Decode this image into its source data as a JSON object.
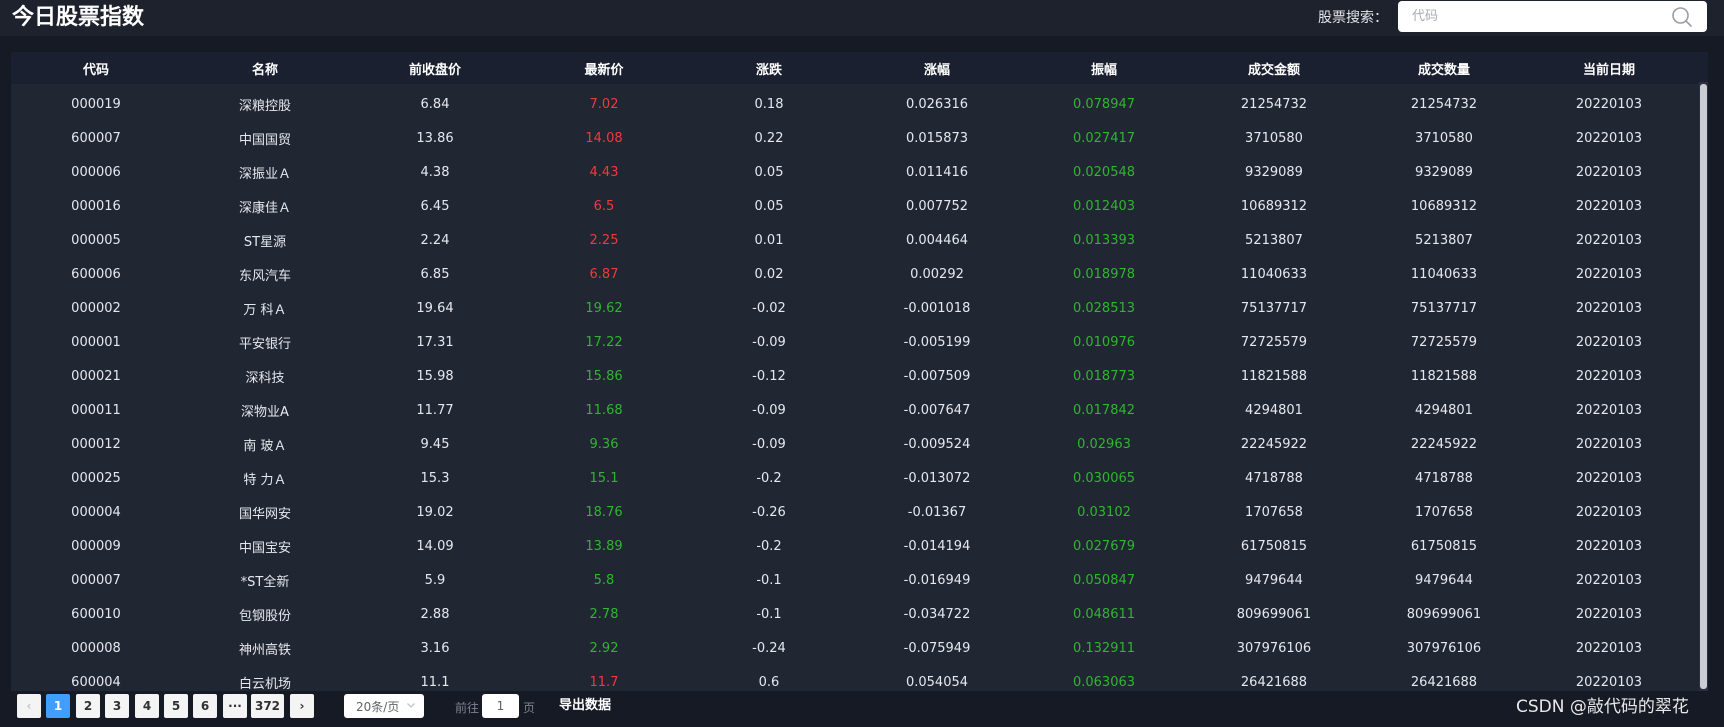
{
  "header": {
    "title": "今日股票指数",
    "search_label": "股票搜索：",
    "search_placeholder": "代码",
    "search_value": ""
  },
  "table": {
    "columns": [
      "代码",
      "名称",
      "前收盘价",
      "最新价",
      "涨跌",
      "涨幅",
      "振幅",
      "成交金额",
      "成交数量",
      "当前日期"
    ],
    "rows": [
      [
        "000019",
        "深粮控股",
        "6.84",
        "7.02",
        "0.18",
        "0.026316",
        "0.078947",
        "21254732",
        "21254732",
        "20220103"
      ],
      [
        "600007",
        "中国国贸",
        "13.86",
        "14.08",
        "0.22",
        "0.015873",
        "0.027417",
        "3710580",
        "3710580",
        "20220103"
      ],
      [
        "000006",
        "深振业Ａ",
        "4.38",
        "4.43",
        "0.05",
        "0.011416",
        "0.020548",
        "9329089",
        "9329089",
        "20220103"
      ],
      [
        "000016",
        "深康佳Ａ",
        "6.45",
        "6.5",
        "0.05",
        "0.007752",
        "0.012403",
        "10689312",
        "10689312",
        "20220103"
      ],
      [
        "000005",
        "ST星源",
        "2.24",
        "2.25",
        "0.01",
        "0.004464",
        "0.013393",
        "5213807",
        "5213807",
        "20220103"
      ],
      [
        "600006",
        "东风汽车",
        "6.85",
        "6.87",
        "0.02",
        "0.00292",
        "0.018978",
        "11040633",
        "11040633",
        "20220103"
      ],
      [
        "000002",
        "万 科Ａ",
        "19.64",
        "19.62",
        "-0.02",
        "-0.001018",
        "0.028513",
        "75137717",
        "75137717",
        "20220103"
      ],
      [
        "000001",
        "平安银行",
        "17.31",
        "17.22",
        "-0.09",
        "-0.005199",
        "0.010976",
        "72725579",
        "72725579",
        "20220103"
      ],
      [
        "000021",
        "深科技",
        "15.98",
        "15.86",
        "-0.12",
        "-0.007509",
        "0.018773",
        "11821588",
        "11821588",
        "20220103"
      ],
      [
        "000011",
        "深物业A",
        "11.77",
        "11.68",
        "-0.09",
        "-0.007647",
        "0.017842",
        "4294801",
        "4294801",
        "20220103"
      ],
      [
        "000012",
        "南 玻Ａ",
        "9.45",
        "9.36",
        "-0.09",
        "-0.009524",
        "0.02963",
        "22245922",
        "22245922",
        "20220103"
      ],
      [
        "000025",
        "特 力Ａ",
        "15.3",
        "15.1",
        "-0.2",
        "-0.013072",
        "0.030065",
        "4718788",
        "4718788",
        "20220103"
      ],
      [
        "000004",
        "国华网安",
        "19.02",
        "18.76",
        "-0.26",
        "-0.01367",
        "0.03102",
        "1707658",
        "1707658",
        "20220103"
      ],
      [
        "000009",
        "中国宝安",
        "14.09",
        "13.89",
        "-0.2",
        "-0.014194",
        "0.027679",
        "61750815",
        "61750815",
        "20220103"
      ],
      [
        "000007",
        "*ST全新",
        "5.9",
        "5.8",
        "-0.1",
        "-0.016949",
        "0.050847",
        "9479644",
        "9479644",
        "20220103"
      ],
      [
        "600010",
        "包钢股份",
        "2.88",
        "2.78",
        "-0.1",
        "-0.034722",
        "0.048611",
        "809699061",
        "809699061",
        "20220103"
      ],
      [
        "000008",
        "神州高铁",
        "3.16",
        "2.92",
        "-0.24",
        "-0.075949",
        "0.132911",
        "307976106",
        "307976106",
        "20220103"
      ],
      [
        "600004",
        "白云机场",
        "11.1",
        "11.7",
        "0.6",
        "0.054054",
        "0.063063",
        "26421688",
        "26421688",
        "20220103"
      ]
    ]
  },
  "pagination": {
    "prev_glyph": "‹",
    "next_glyph": "›",
    "pages": [
      "1",
      "2",
      "3",
      "4",
      "5",
      "6"
    ],
    "active_page": "1",
    "more": "···",
    "last_page": "372",
    "page_size": "20条/页",
    "jump_prefix": "前往",
    "jump_value": "1",
    "jump_suffix": "页",
    "export_label": "导出数据"
  },
  "colors": {
    "up": "#f03a3a",
    "down": "#2fb52f",
    "accent": "#409eff"
  },
  "watermark": "CSDN @敲代码的翠花"
}
